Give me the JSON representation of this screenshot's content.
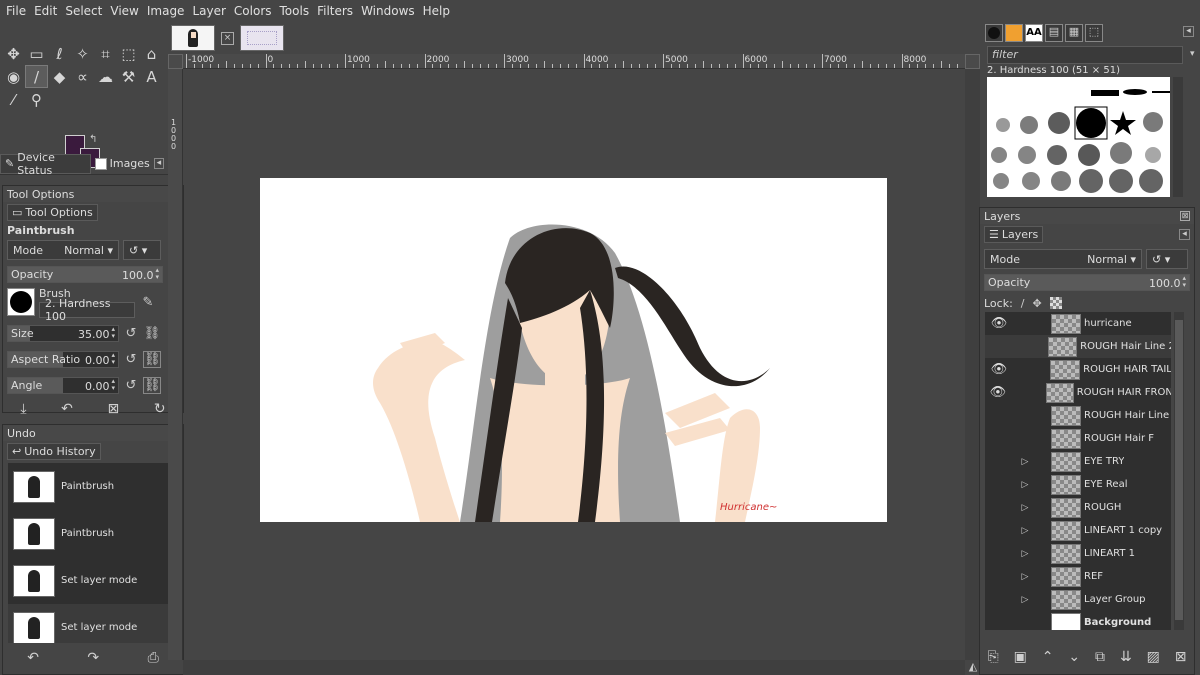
{
  "menu": [
    "File",
    "Edit",
    "Select",
    "View",
    "Image",
    "Layer",
    "Colors",
    "Tools",
    "Filters",
    "Windows",
    "Help"
  ],
  "toolbox": {
    "tools": [
      "move-icon",
      "rect-select-icon",
      "lasso-icon",
      "fuzzy-select-icon",
      "crop-icon",
      "transform-icon",
      "warp-icon",
      "bucket-fill-icon",
      "paintbrush-icon",
      "eraser-icon",
      "airbrush-icon",
      "smudge-icon",
      "clone-icon",
      "text-icon",
      "color-picker-icon",
      "zoom-icon"
    ],
    "fg_color": "#3a1a3d",
    "bg_color": "#3a1a3d",
    "tabs": [
      "Device Status",
      "Images"
    ]
  },
  "tool_options": {
    "title": "Tool Options",
    "tab": "Tool Options",
    "tool_name": "Paintbrush",
    "mode_label": "Mode",
    "mode_value": "Normal",
    "opacity_label": "Opacity",
    "opacity_value": "100.0",
    "brush_label": "Brush",
    "brush_value": "2. Hardness 100",
    "size_label": "Size",
    "size_value": "35.00",
    "aspect_label": "Aspect Ratio",
    "aspect_value": "0.00",
    "angle_label": "Angle",
    "angle_value": "0.00"
  },
  "undo": {
    "title": "Undo",
    "tab": "Undo History",
    "items": [
      "Paintbrush",
      "Paintbrush",
      "Set layer mode",
      "Set layer mode"
    ]
  },
  "canvas": {
    "ruler_labels": [
      "-1000",
      "0",
      "1000",
      "2000",
      "3000",
      "4000",
      "5000",
      "6000",
      "7000",
      "8000"
    ],
    "vruler_label": "1000",
    "signature": "Hurricane~"
  },
  "brushes": {
    "filter_placeholder": "filter",
    "selected_brush": "2. Hardness 100 (51 × 51)"
  },
  "layers": {
    "title": "Layers",
    "tab": "Layers",
    "mode_label": "Mode",
    "mode_value": "Normal",
    "opacity_label": "Opacity",
    "opacity_value": "100.0",
    "lock_label": "Lock:",
    "items": [
      {
        "name": "hurricane",
        "visible": true,
        "group": false
      },
      {
        "name": "ROUGH Hair Line 2",
        "visible": false,
        "group": false
      },
      {
        "name": "ROUGH HAIR TAIL",
        "visible": true,
        "group": false
      },
      {
        "name": "ROUGH HAIR FRONT",
        "visible": true,
        "group": false
      },
      {
        "name": "ROUGH Hair Line",
        "visible": false,
        "group": false
      },
      {
        "name": "ROUGH Hair F",
        "visible": false,
        "group": false
      },
      {
        "name": "EYE TRY",
        "visible": false,
        "group": true
      },
      {
        "name": "EYE Real",
        "visible": false,
        "group": true
      },
      {
        "name": "ROUGH",
        "visible": false,
        "group": true
      },
      {
        "name": "LINEART 1 copy",
        "visible": false,
        "group": true
      },
      {
        "name": "LINEART 1",
        "visible": false,
        "group": true
      },
      {
        "name": "REF",
        "visible": false,
        "group": true
      },
      {
        "name": "Layer Group",
        "visible": false,
        "group": true
      },
      {
        "name": "Background",
        "visible": false,
        "group": false
      }
    ]
  }
}
